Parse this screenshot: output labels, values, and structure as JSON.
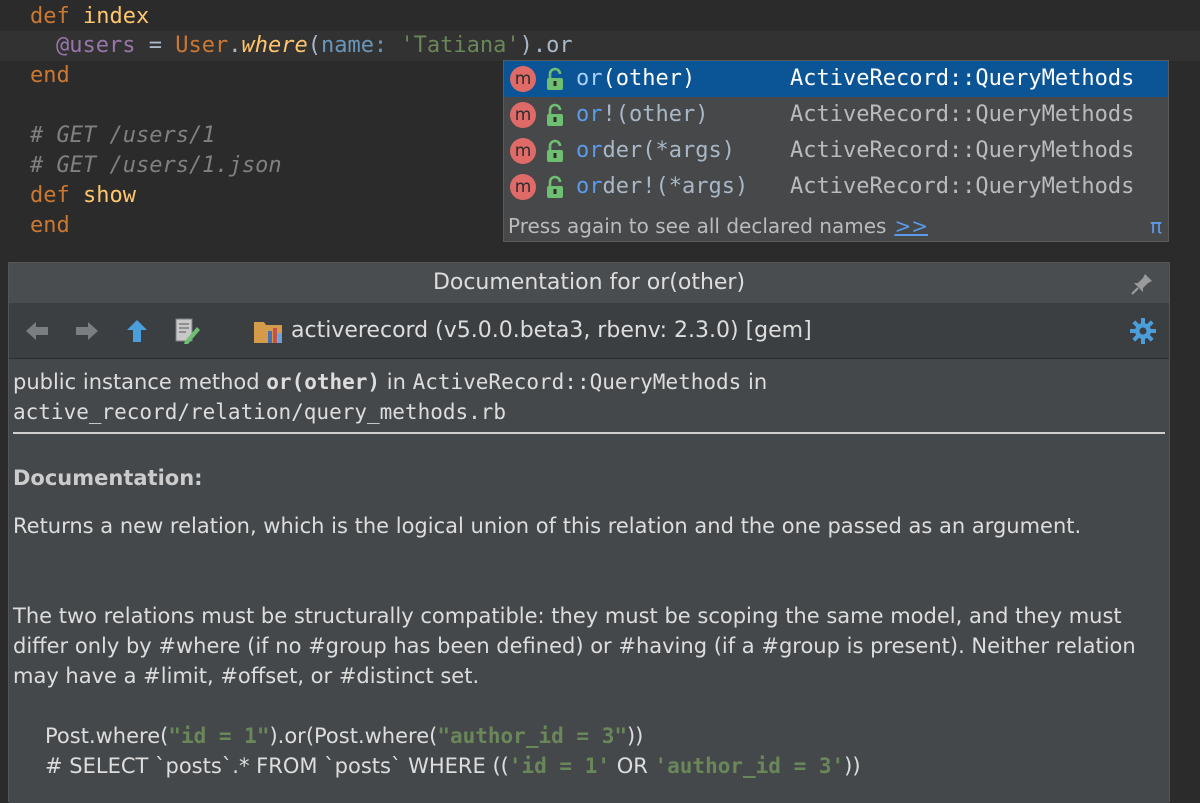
{
  "editor": {
    "line1": {
      "kw": "def",
      "name": "index"
    },
    "line2": {
      "ivar": "@users",
      "eq": " = ",
      "const": "User",
      "dot": ".",
      "meth": "where",
      "paren_open": "(",
      "sym": "name:",
      "sp": " ",
      "str": "'Tatiana'",
      "tail": ").or"
    },
    "line3": {
      "kw": "end"
    },
    "line5": {
      "comment": "# GET /users/1"
    },
    "line6": {
      "comment": "# GET /users/1.json"
    },
    "line7": {
      "kw": "def",
      "name": "show"
    },
    "line8": {
      "kw": "end"
    }
  },
  "completion": {
    "items": [
      {
        "badge": "m",
        "match": "or",
        "rest": "(other)",
        "type": "ActiveRecord::QueryMethods",
        "selected": true
      },
      {
        "badge": "m",
        "match": "or",
        "rest": "!(other)",
        "type": "ActiveRecord::QueryMethods",
        "selected": false
      },
      {
        "badge": "m",
        "match": "or",
        "rest": "der(*args)",
        "type": "ActiveRecord::QueryMethods",
        "selected": false
      },
      {
        "badge": "m",
        "match": "or",
        "rest": "der!(*args)",
        "type": "ActiveRecord::QueryMethods",
        "selected": false
      }
    ],
    "hint": "Press again to see all declared names",
    "hint_link": ">>",
    "pi": "π"
  },
  "doc": {
    "title": "Documentation for or(other)",
    "library": "activerecord (v5.0.0.beta3, rbenv: 2.3.0) [gem]",
    "signature": {
      "prefix": "public instance method ",
      "name": "or(other)",
      "in1": " in ",
      "klass": "ActiveRecord::QueryMethods",
      "in2": " in ",
      "path": "active_record/relation/query_methods.rb"
    },
    "section": "Documentation:",
    "para1": "Returns a new relation, which is the logical union of this relation and the one passed as an argument.",
    "para2": "The two relations must be structurally compatible: they must be scoping the same model, and they must differ only by #where (if no #group has been defined) or #having (if a #group is present). Neither relation may have a #limit, #offset, or #distinct set.",
    "example1": {
      "a": "Post.where(",
      "s1": "\"id = 1\"",
      "b": ").or(Post.where(",
      "s2": "\"author_id = 3\"",
      "c": "))"
    },
    "example2": {
      "a": "# SELECT `posts`.* FROM `posts` WHERE ((",
      "s1": "'id = 1'",
      "b": " OR ",
      "s2": "'author_id = 3'",
      "c": "))"
    }
  }
}
